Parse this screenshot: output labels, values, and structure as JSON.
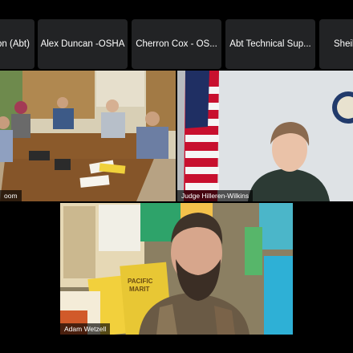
{
  "participants_strip": [
    {
      "name": "on (Abt)"
    },
    {
      "name": "Alex Duncan -OSHA"
    },
    {
      "name": "Cherron Cox - OS..."
    },
    {
      "name": "Abt Technical Sup..."
    },
    {
      "name": "Sheila"
    }
  ],
  "videos": {
    "room": {
      "label": "oom"
    },
    "judge": {
      "label": "Judge Hilleren-Wilkins"
    },
    "speaker": {
      "label": "Adam Wetzell"
    }
  }
}
